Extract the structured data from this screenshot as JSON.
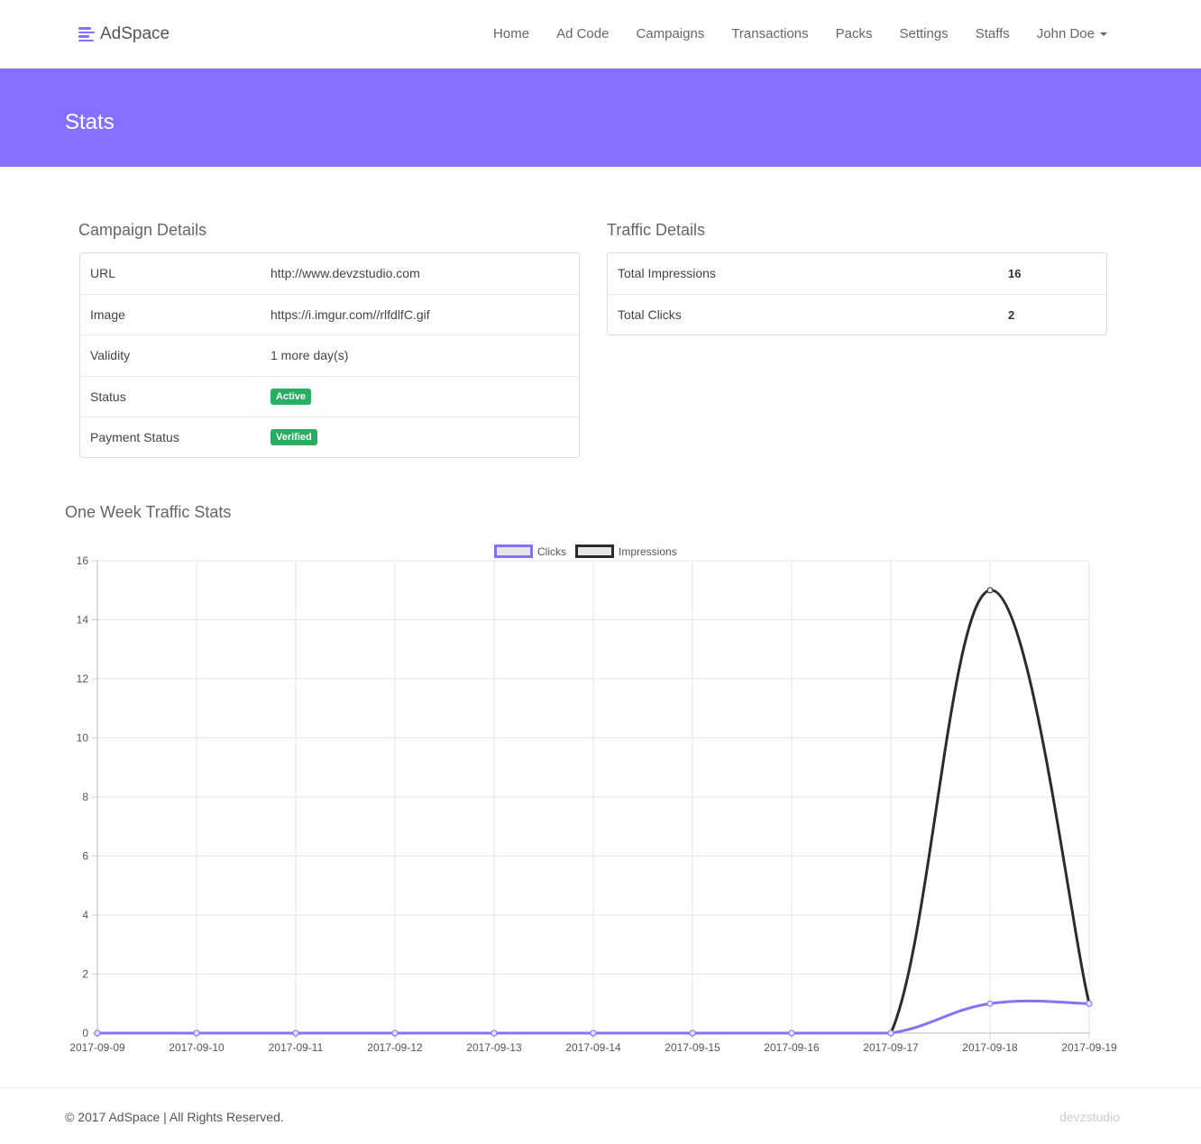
{
  "brand": {
    "name": "AdSpace"
  },
  "nav": {
    "items": [
      "Home",
      "Ad Code",
      "Campaigns",
      "Transactions",
      "Packs",
      "Settings",
      "Staffs"
    ],
    "user": "John Doe"
  },
  "banner": {
    "title": "Stats"
  },
  "campaign": {
    "title": "Campaign Details",
    "rows": [
      {
        "label": "URL",
        "value": "http://www.devzstudio.com"
      },
      {
        "label": "Image",
        "value": "https://i.imgur.com//rlfdlfC.gif"
      },
      {
        "label": "Validity",
        "value": "1 more day(s)"
      },
      {
        "label": "Status",
        "value": "Active"
      },
      {
        "label": "Payment Status",
        "value": "Verified"
      }
    ]
  },
  "traffic": {
    "title": "Traffic Details",
    "rows": [
      {
        "label": "Total Impressions",
        "value": "16"
      },
      {
        "label": "Total Clicks",
        "value": "2"
      }
    ]
  },
  "chart_section": {
    "title": "One Week Traffic Stats"
  },
  "chart_data": {
    "type": "line",
    "categories": [
      "2017-09-09",
      "2017-09-10",
      "2017-09-11",
      "2017-09-12",
      "2017-09-13",
      "2017-09-14",
      "2017-09-15",
      "2017-09-16",
      "2017-09-17",
      "2017-09-18",
      "2017-09-19"
    ],
    "series": [
      {
        "name": "Clicks",
        "color": "#8670ff",
        "values": [
          0,
          0,
          0,
          0,
          0,
          0,
          0,
          0,
          0,
          1,
          1
        ]
      },
      {
        "name": "Impressions",
        "color": "#2b2b2b",
        "values": [
          0,
          0,
          0,
          0,
          0,
          0,
          0,
          0,
          0,
          15,
          1
        ]
      }
    ],
    "ylim": [
      0,
      16
    ],
    "yticks": [
      0,
      2,
      4,
      6,
      8,
      10,
      12,
      14,
      16
    ],
    "grid": true,
    "legend": "top-center"
  },
  "footer": {
    "copyright": "© 2017 AdSpace | All Rights Reserved.",
    "credit": "devzstudio"
  }
}
